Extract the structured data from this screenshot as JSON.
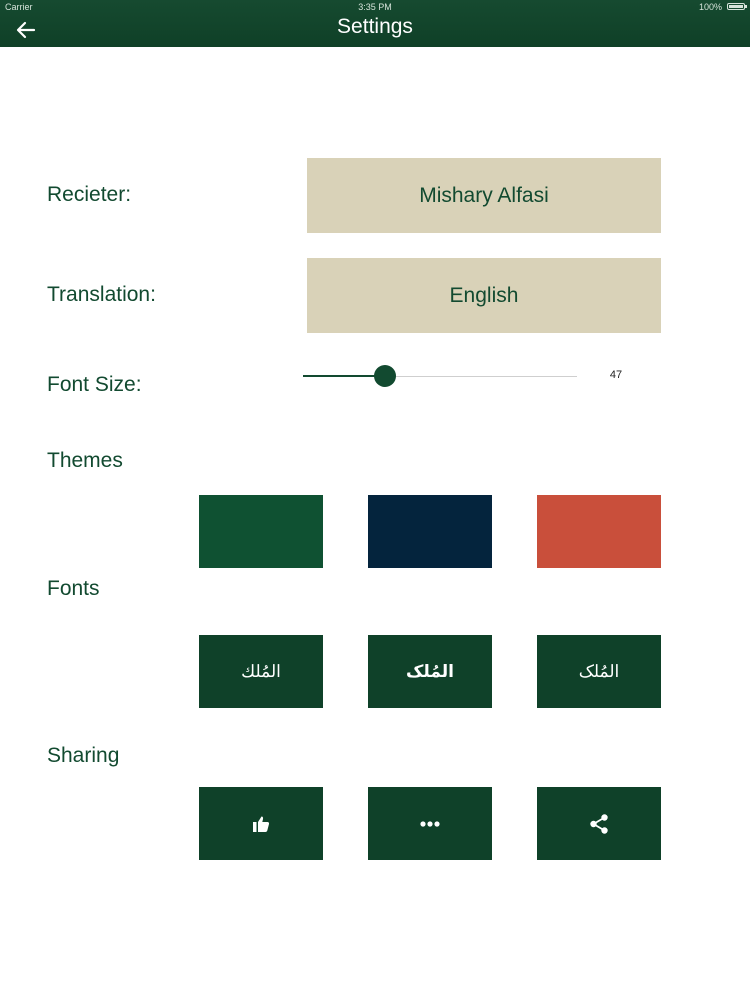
{
  "status_bar": {
    "carrier": "Carrier",
    "time": "3:35 PM",
    "battery": "100%"
  },
  "header": {
    "title": "Settings",
    "back_icon": "arrow-left-icon"
  },
  "settings": {
    "reciter": {
      "label": "Recieter:",
      "value": "Mishary Alfasi"
    },
    "translation": {
      "label": "Translation:",
      "value": "English"
    },
    "font_size": {
      "label": "Font Size:",
      "value": 47,
      "slider_fraction": 0.3
    }
  },
  "themes": {
    "label": "Themes",
    "colors": [
      "#0f5132",
      "#04243d",
      "#c94f3b"
    ]
  },
  "fonts": {
    "label": "Fonts",
    "samples": [
      "المُلك",
      "المُلک",
      "المُلک"
    ]
  },
  "sharing": {
    "label": "Sharing",
    "icons": [
      "thumbs-up-icon",
      "more-dots-icon",
      "share-icon"
    ]
  },
  "colors": {
    "primary": "#124a30",
    "picker_bg": "#d9d2b8",
    "header_bg": "#0f4027"
  }
}
